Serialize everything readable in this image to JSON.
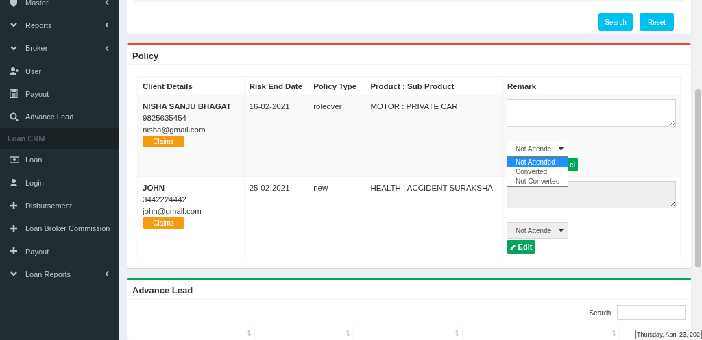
{
  "sidebar": {
    "items": [
      {
        "label": "Master",
        "kind": "item",
        "submenu": true
      },
      {
        "label": "Reports",
        "kind": "item",
        "submenu": true
      },
      {
        "label": "Broker",
        "kind": "item",
        "submenu": true
      },
      {
        "label": "User",
        "kind": "item",
        "submenu": false
      },
      {
        "label": "Payout",
        "kind": "item",
        "submenu": false
      },
      {
        "label": "Advance Lead",
        "kind": "item",
        "submenu": false
      },
      {
        "label": "Loan CRM",
        "kind": "header"
      },
      {
        "label": "Loan",
        "kind": "item",
        "submenu": false
      },
      {
        "label": "Login",
        "kind": "item",
        "submenu": false
      },
      {
        "label": "Disbursement",
        "kind": "item",
        "submenu": false
      },
      {
        "label": "Loan Broker Commission",
        "kind": "item",
        "submenu": false
      },
      {
        "label": "Payout",
        "kind": "item",
        "submenu": false
      },
      {
        "label": "Loan Reports",
        "kind": "item",
        "submenu": true
      }
    ]
  },
  "filter_panel": {
    "buttons": [
      "Search",
      "Reset"
    ]
  },
  "policy": {
    "title": "Policy",
    "columns": [
      "Client Details",
      "Risk End Date",
      "Policy Type",
      "Product : Sub Product",
      "Remark"
    ],
    "rows": [
      {
        "name": "NISHA SANJU BHAGAT",
        "phone": "9825635454",
        "email": "nisha@gmail.com",
        "claims_button": "Claims",
        "risk_end_date": "16-02-2021",
        "policy_type": "roleover",
        "product": "MOTOR : PRIVATE CAR",
        "remark": {
          "disabled": false,
          "select_value": "Not Attende",
          "open": true,
          "options": [
            {
              "label": "Not Attended",
              "selected": true
            },
            {
              "label": "Converted",
              "selected": false
            },
            {
              "label": "Not Converted",
              "selected": false
            }
          ],
          "button": {
            "label": "el",
            "kind": "plain"
          }
        }
      },
      {
        "name": "JOHN",
        "phone": "3442224442",
        "email": "john@gmail.com",
        "claims_button": "Claims",
        "risk_end_date": "25-02-2021",
        "policy_type": "new",
        "product": "HEALTH : ACCIDENT SURAKSHA",
        "remark": {
          "disabled": true,
          "select_value": "Not Attende",
          "open": false,
          "button": {
            "label": "Edit",
            "kind": "edit"
          }
        }
      }
    ]
  },
  "advance_lead": {
    "title": "Advance Lead",
    "search_label": "Search:",
    "columns": [
      {
        "sortable": true
      },
      {
        "sortable": true
      },
      {
        "sortable": true
      },
      {
        "sortable": true
      }
    ]
  },
  "tooltip": "Thursday, April 23, 202"
}
